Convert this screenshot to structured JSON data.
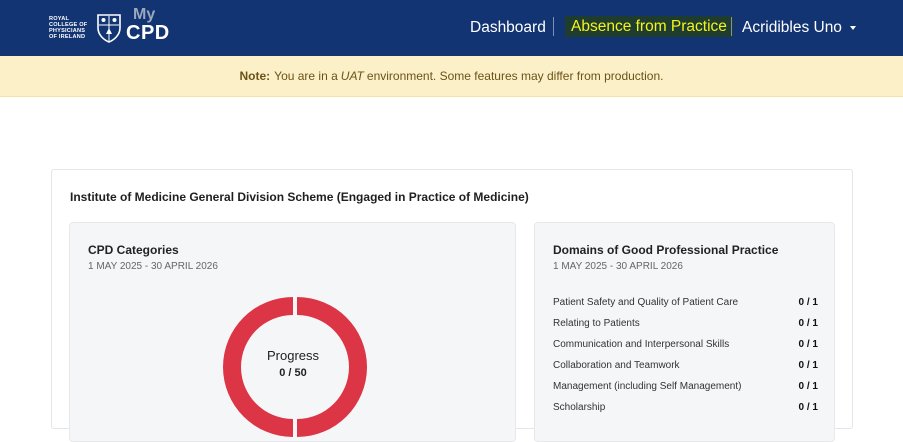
{
  "header": {
    "logo_text": [
      "ROYAL",
      "COLLEGE OF",
      "PHYSICIANS",
      "OF IRELAND"
    ],
    "logo_my": "My",
    "logo_cpd": "CPD",
    "nav": {
      "dashboard": "Dashboard",
      "absence": "Absence from Practice",
      "user": "Acridibles Uno"
    },
    "colors": {
      "navbar": "#123473",
      "highlight": "#f6f31a"
    }
  },
  "note": {
    "label": "Note:",
    "text_before": "You are in a",
    "env": "UAT",
    "text_after": "environment. Some features may differ from production."
  },
  "scheme": {
    "title": "Institute of Medicine General Division Scheme  (Engaged in Practice of Medicine)"
  },
  "cpd_categories": {
    "title": "CPD Categories",
    "date_range": "1 MAY 2025 - 30 APRIL 2026",
    "progress_label": "Progress",
    "progress_value": "0 / 50",
    "progress_fraction": 0,
    "ring_color": "#dc3545"
  },
  "domains": {
    "title": "Domains of Good Professional Practice",
    "date_range": "1 MAY 2025 - 30 APRIL 2026",
    "items": [
      {
        "label": "Patient Safety and Quality of Patient Care",
        "value": "0 / 1"
      },
      {
        "label": "Relating to Patients",
        "value": "0 / 1"
      },
      {
        "label": "Communication and Interpersonal Skills",
        "value": "0 / 1"
      },
      {
        "label": "Collaboration and Teamwork",
        "value": "0 / 1"
      },
      {
        "label": "Management (including Self Management)",
        "value": "0 / 1"
      },
      {
        "label": "Scholarship",
        "value": "0 / 1"
      }
    ]
  }
}
